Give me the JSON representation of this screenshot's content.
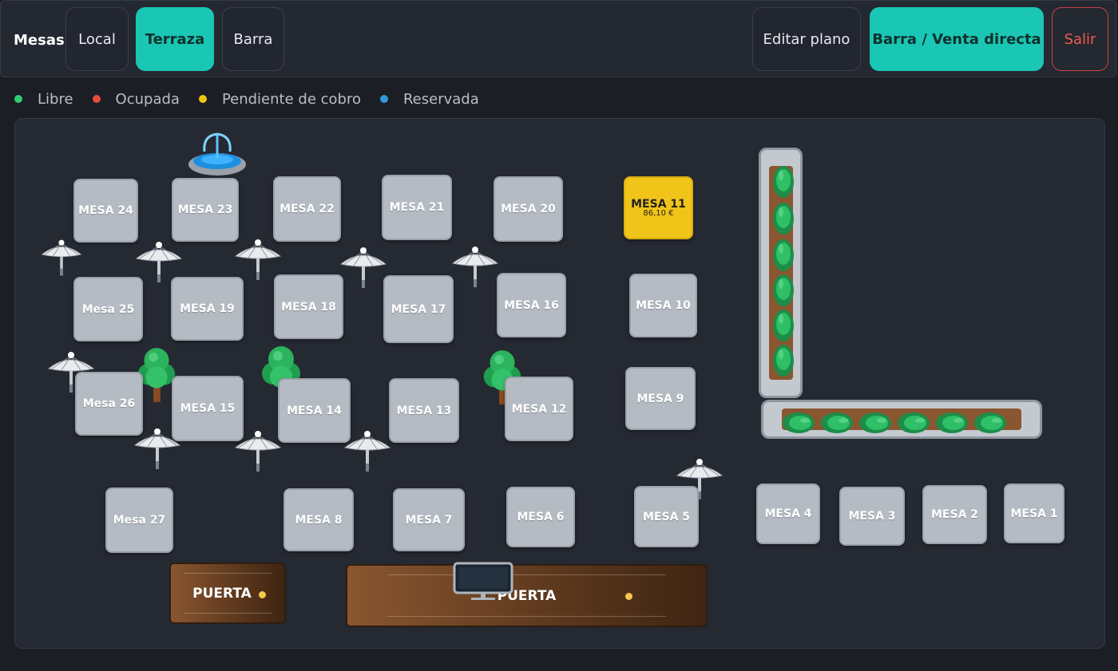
{
  "header": {
    "title": "Mesas",
    "tabs": [
      {
        "label": "Local",
        "active": false
      },
      {
        "label": "Terraza",
        "active": true
      },
      {
        "label": "Barra",
        "active": false
      }
    ],
    "edit_label": "Editar plano",
    "barra_label": "Barra / Venta directa",
    "exit_label": "Salir"
  },
  "legend": [
    {
      "label": "Libre",
      "color": "#2ecc71"
    },
    {
      "label": "Ocupada",
      "color": "#e74c3c"
    },
    {
      "label": "Pendiente de cobro",
      "color": "#f1c40f"
    },
    {
      "label": "Reservada",
      "color": "#3498db"
    }
  ],
  "tables": [
    {
      "label": "MESA 24",
      "status": "libre"
    },
    {
      "label": "MESA 23",
      "status": "libre"
    },
    {
      "label": "MESA 22",
      "status": "libre"
    },
    {
      "label": "MESA 21",
      "status": "libre"
    },
    {
      "label": "MESA 20",
      "status": "libre"
    },
    {
      "label": "MESA 11",
      "status": "pendiente",
      "amount": "86,10 €"
    },
    {
      "label": "Mesa 25",
      "status": "libre"
    },
    {
      "label": "MESA 19",
      "status": "libre"
    },
    {
      "label": "MESA 18",
      "status": "libre"
    },
    {
      "label": "MESA 17",
      "status": "libre"
    },
    {
      "label": "MESA 16",
      "status": "libre"
    },
    {
      "label": "MESA 10",
      "status": "libre"
    },
    {
      "label": "Mesa 26",
      "status": "libre"
    },
    {
      "label": "MESA 15",
      "status": "libre"
    },
    {
      "label": "MESA 14",
      "status": "libre"
    },
    {
      "label": "MESA 13",
      "status": "libre"
    },
    {
      "label": "MESA 12",
      "status": "libre"
    },
    {
      "label": "MESA 9",
      "status": "libre"
    },
    {
      "label": "Mesa 27",
      "status": "libre"
    },
    {
      "label": "MESA 8",
      "status": "libre"
    },
    {
      "label": "MESA 7",
      "status": "libre"
    },
    {
      "label": "MESA 6",
      "status": "libre"
    },
    {
      "label": "MESA 5",
      "status": "libre"
    },
    {
      "label": "MESA 4",
      "status": "libre"
    },
    {
      "label": "MESA 3",
      "status": "libre"
    },
    {
      "label": "MESA 2",
      "status": "libre"
    },
    {
      "label": "MESA 1",
      "status": "libre"
    }
  ],
  "doors": [
    {
      "label": "PUERTA"
    },
    {
      "label": "PUERTA"
    }
  ],
  "decorations": {
    "fountain_icon": "fountain-icon",
    "umbrella_icon": "parasol-icon",
    "tree_icon": "tree-icon",
    "planter_icon": "planter-icon",
    "monitor_icon": "monitor-icon"
  }
}
